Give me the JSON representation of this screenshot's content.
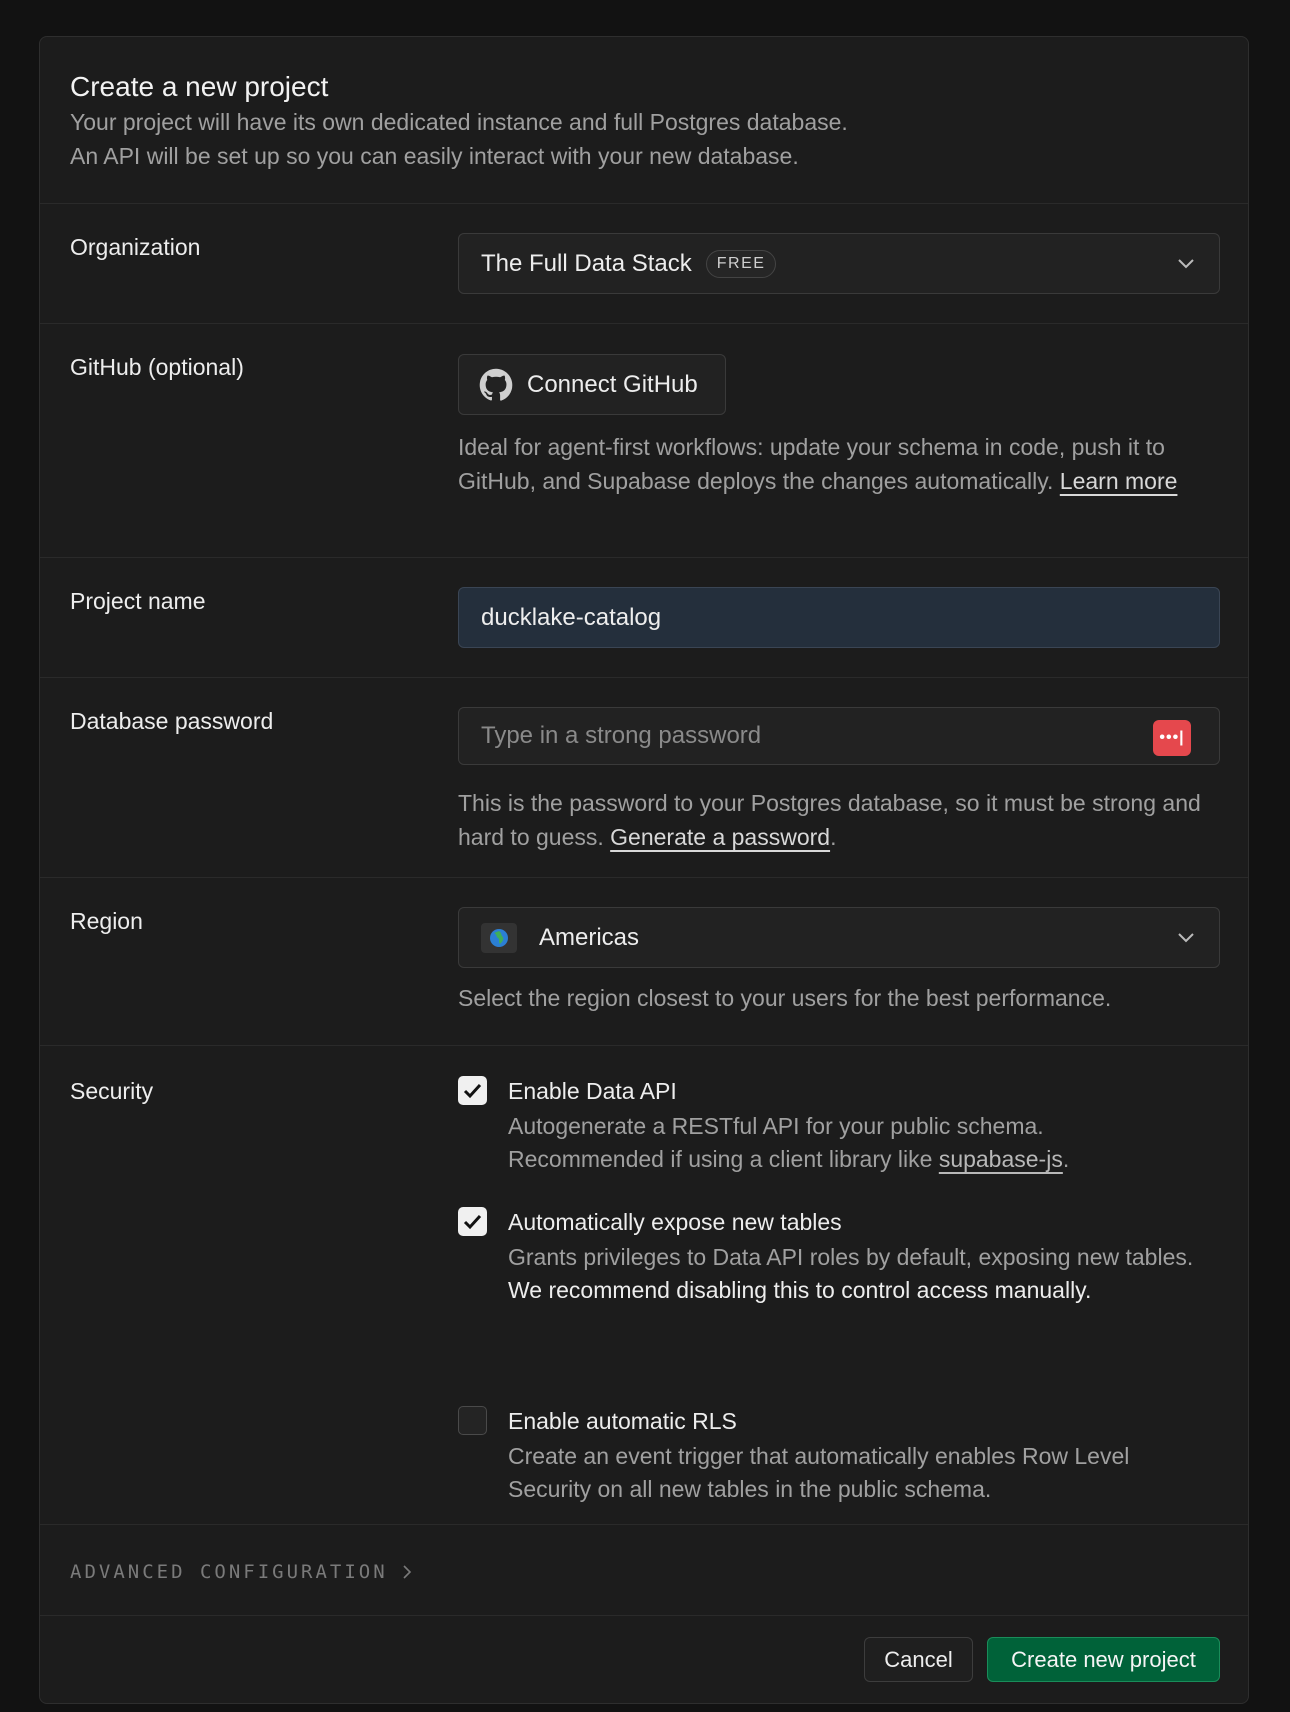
{
  "header": {
    "title": "Create a new project",
    "desc_line1": "Your project will have its own dedicated instance and full Postgres database.",
    "desc_line2": "An API will be set up so you can easily interact with your new database."
  },
  "organization": {
    "label": "Organization",
    "value": "The Full Data Stack",
    "badge": "FREE"
  },
  "github": {
    "label": "GitHub (optional)",
    "button_label": "Connect GitHub",
    "help_text": "Ideal for agent-first workflows: update your schema in code, push it to GitHub, and Supabase deploys the changes automatically. ",
    "learn_more": "Learn more"
  },
  "project_name": {
    "label": "Project name",
    "value": "ducklake-catalog"
  },
  "db_password": {
    "label": "Database password",
    "placeholder": "Type in a strong password",
    "help_text": "This is the password to your Postgres database, so it must be strong and hard to guess. ",
    "generate_link": "Generate a password",
    "help_suffix": "."
  },
  "region": {
    "label": "Region",
    "value": "Americas",
    "help_text": "Select the region closest to your users for the best performance."
  },
  "security": {
    "label": "Security",
    "options": [
      {
        "title": "Enable Data API",
        "checked": true,
        "desc_line1": "Autogenerate a RESTful API for your public schema.",
        "desc_line2": "Recommended if using a client library like ",
        "link": "supabase-js",
        "suffix": "."
      },
      {
        "title": "Automatically expose new tables",
        "checked": true,
        "desc": "Grants privileges to Data API roles by default, exposing new tables.",
        "strong": "We recommend disabling this to control access manually."
      },
      {
        "title": "Enable automatic RLS",
        "checked": false,
        "desc": "Create an event trigger that automatically enables Row Level Security on all new tables in the public schema."
      }
    ]
  },
  "advanced": {
    "label": "ADVANCED CONFIGURATION"
  },
  "footer": {
    "cancel_label": "Cancel",
    "create_label": "Create new project"
  },
  "colors": {
    "accent": "#006239",
    "password_icon": "#e5484d"
  }
}
